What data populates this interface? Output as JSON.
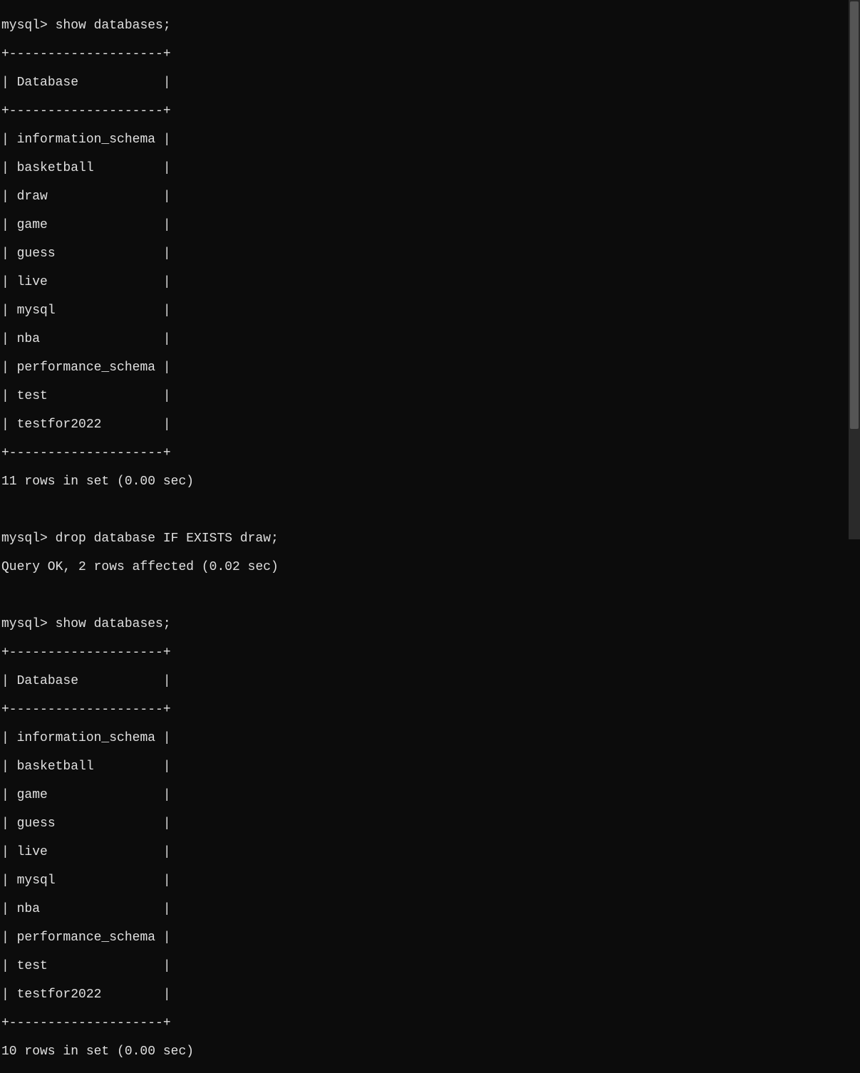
{
  "session": {
    "prompt": "mysql>",
    "commands": [
      {
        "cmd": "show databases;",
        "table": {
          "header": "Database",
          "border_top": "+--------------------+",
          "border_sep": "+--------------------+",
          "border_bot": "+--------------------+",
          "rows": [
            "information_schema",
            "basketball",
            "draw",
            "game",
            "guess",
            "live",
            "mysql",
            "nba",
            "performance_schema",
            "test",
            "testfor2022"
          ],
          "footer": "11 rows in set (0.00 sec)"
        }
      },
      {
        "cmd": "drop database IF EXISTS draw;",
        "result": "Query OK, 2 rows affected (0.02 sec)"
      },
      {
        "cmd": "show databases;",
        "table": {
          "header": "Database",
          "border_top": "+--------------------+",
          "border_sep": "+--------------------+",
          "border_bot": "+--------------------+",
          "rows": [
            "information_schema",
            "basketball",
            "game",
            "guess",
            "live",
            "mysql",
            "nba",
            "performance_schema",
            "test",
            "testfor2022"
          ],
          "footer": "10 rows in set (0.00 sec)"
        }
      }
    ]
  }
}
